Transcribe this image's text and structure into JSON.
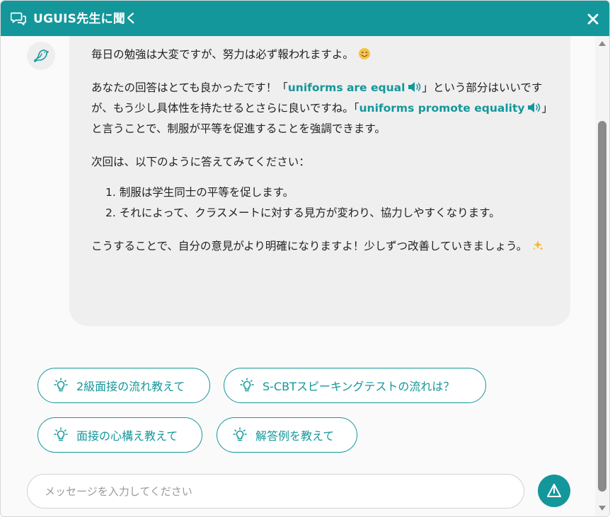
{
  "header": {
    "title": "UGUIS先生に聞く",
    "chat_icon": "chat-bubbles-icon",
    "close_icon": "close-icon"
  },
  "message": {
    "avatar_icon": "bird-icon",
    "p1": "毎日の勉強は大変ですが、努力は必ず報われますよ。",
    "p1_emoji": "smiling-face-emoji",
    "p2_part1": "あなたの回答はとても良かったです！「",
    "p2_hl1": "uniforms are equal",
    "p2_part2": "」という部分はいいですが、もう少し具体性を持たせるとさらに良いですね。「",
    "p2_hl2": "uniforms promote equality",
    "p2_part3": "」と言うことで、制服が平等を促進することを強調できます。",
    "p3": "次回は、以下のように答えてみてください：",
    "list": [
      "1. 制服は学生同士の平等を促します。",
      "2. それによって、クラスメートに対する見方が変わり、協力しやすくなります。"
    ],
    "p4": "こうすることで、自分の意見がより明確になりますよ！少しずつ改善していきましょう。",
    "p4_emoji": "sparkles-emoji",
    "speaker_icon": "speaker-icon"
  },
  "suggestions": [
    "2級面接の流れ教えて",
    "S-CBTスピーキングテストの流れは？",
    "面接の心構え教えて",
    "解答例を教えて"
  ],
  "suggestion_icon": "lightbulb-icon",
  "input": {
    "placeholder": "メッセージを入力してください",
    "value": ""
  },
  "send_icon": "send-icon",
  "colors": {
    "accent": "#14979b",
    "bubble": "#efefef"
  }
}
